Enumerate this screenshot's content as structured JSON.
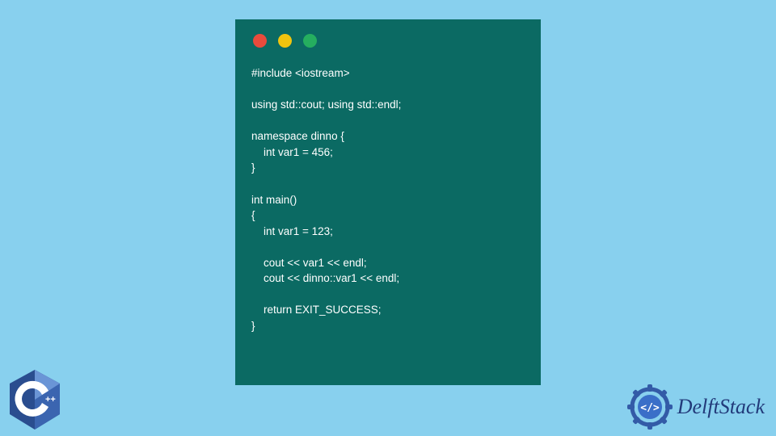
{
  "code": {
    "lines": [
      "#include <iostream>",
      "",
      "using std::cout; using std::endl;",
      "",
      "namespace dinno {",
      "    int var1 = 456;",
      "}",
      "",
      "int main()",
      "{",
      "    int var1 = 123;",
      "",
      "    cout << var1 << endl;",
      "    cout << dinno::var1 << endl;",
      "",
      "    return EXIT_SUCCESS;",
      "}"
    ]
  },
  "badge": {
    "label": "C++"
  },
  "brand": {
    "name": "DelftStack"
  },
  "window": {
    "buttons": {
      "close": "close",
      "minimize": "minimize",
      "zoom": "zoom"
    }
  }
}
